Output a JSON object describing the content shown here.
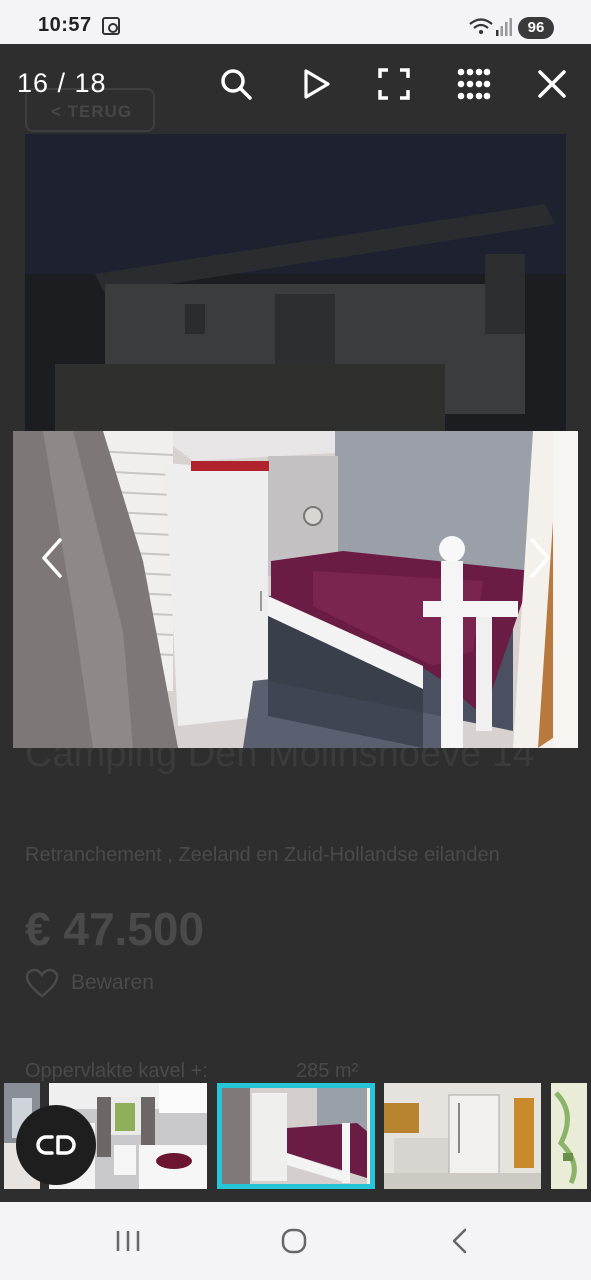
{
  "status_bar": {
    "time": "10:57",
    "battery": "96"
  },
  "background_page": {
    "back_button": "< TERUG",
    "title": "Camping Den Molinshoeve 14",
    "location": "Retranchement , Zeeland en Zuid-Hollandse eilanden",
    "price": "€ 47.500",
    "save_label": "Bewaren",
    "area_label": "Oppervlakte kavel +:",
    "area_value": "285 m²"
  },
  "viewer": {
    "counter": "16 / 18",
    "tools": [
      "search-icon",
      "play-icon",
      "fullscreen-icon",
      "grid-icon",
      "close-icon"
    ],
    "accent_color": "#26c5d7"
  }
}
